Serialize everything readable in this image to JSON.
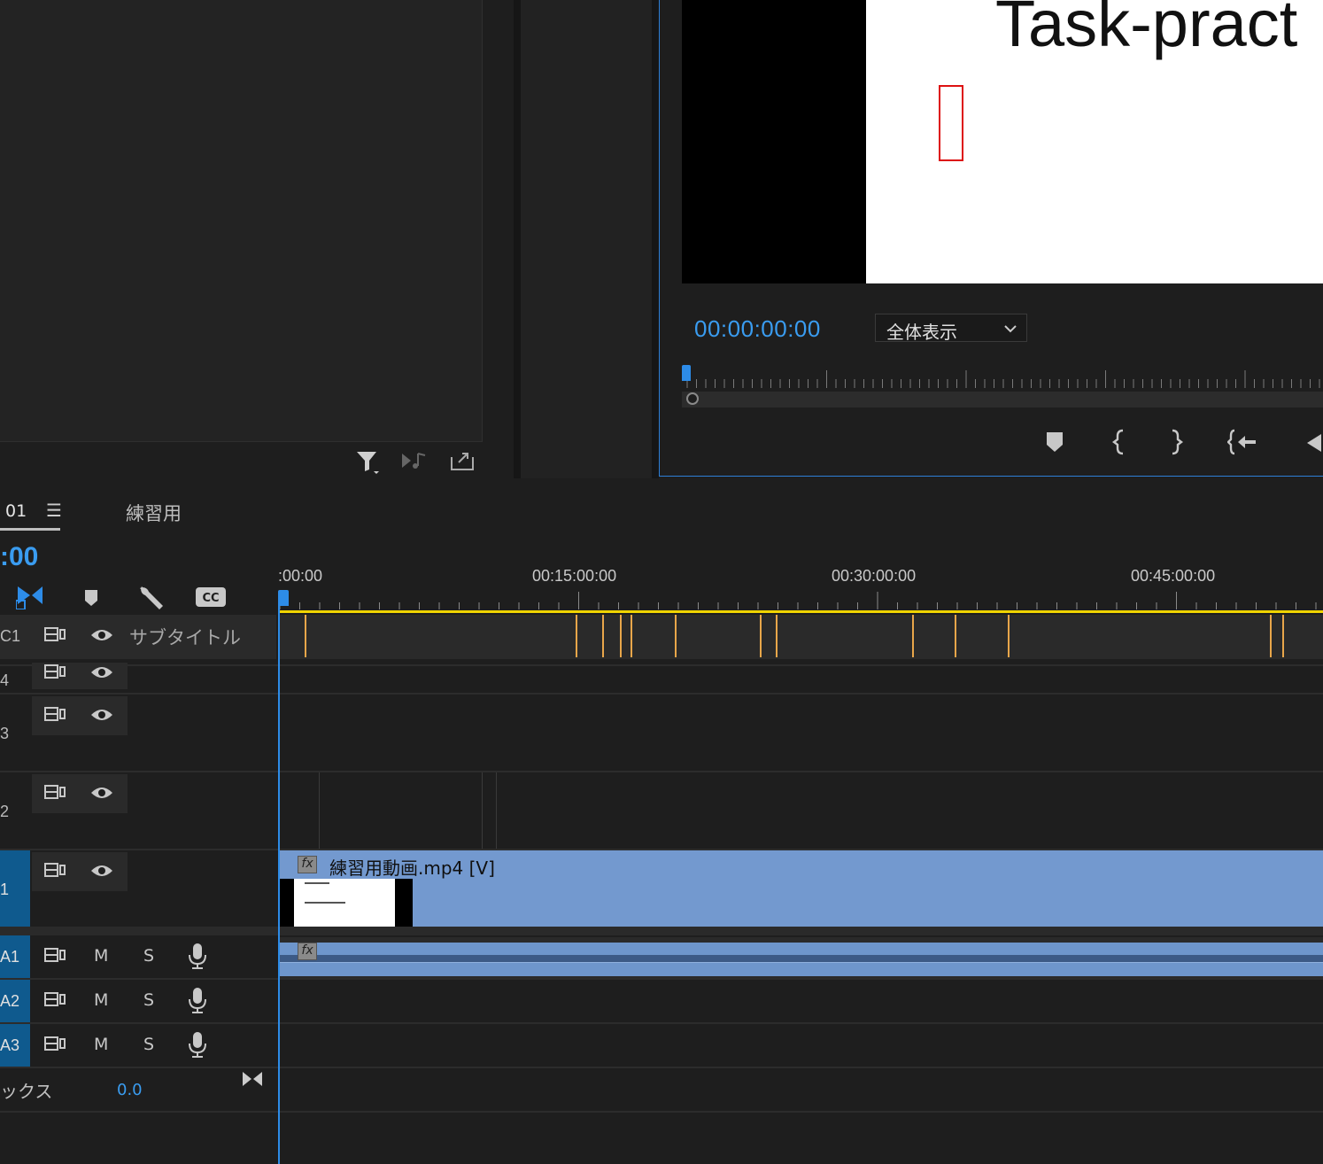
{
  "source_monitor": {
    "footer_icons": [
      "filter-icon",
      "insert-audio-icon",
      "export-icon"
    ]
  },
  "program_monitor": {
    "video_title_text": "Task-pract",
    "timecode": "00:00:00:00",
    "zoom_select": {
      "label": "全体表示",
      "chevron": "⌄"
    },
    "controls": [
      "add-marker-icon",
      "mark-in-icon",
      "mark-out-icon",
      "go-to-in-icon",
      "step-back-icon"
    ]
  },
  "timeline": {
    "tabs": [
      {
        "label": "01",
        "active": true,
        "menu": "☰"
      },
      {
        "label": "練習用",
        "active": false
      }
    ],
    "timecode": ":00",
    "tools": [
      "snap-icon",
      "add-marker-icon",
      "wrench-icon",
      "cc-icon"
    ],
    "ruler_labels": [
      ":00:00",
      "00:15:00:00",
      "00:30:00:00",
      "00:45:00:00"
    ],
    "tracks": {
      "c1": {
        "id": "C1",
        "label": "サブタイトル"
      },
      "v4": {
        "id": "4"
      },
      "v3": {
        "id": "3"
      },
      "v2": {
        "id": "2"
      },
      "v1": {
        "id": "1",
        "clip_label": "練習用動画.mp4 [V]",
        "fx": "fx"
      },
      "a1": {
        "id": "A1",
        "m": "M",
        "s": "S",
        "fx": "fx"
      },
      "a2": {
        "id": "A2",
        "m": "M",
        "s": "S"
      },
      "a3": {
        "id": "A3",
        "m": "M",
        "s": "S"
      }
    },
    "mix": {
      "label": "ックス",
      "value": "0.0"
    }
  },
  "colors": {
    "accent": "#2d8ce8",
    "timecode": "#3a9cf0",
    "clip_video": "#7399cf",
    "clip_audio": "#6e96cc",
    "marker": "#e8a64a",
    "work_area": "#f0d400"
  }
}
